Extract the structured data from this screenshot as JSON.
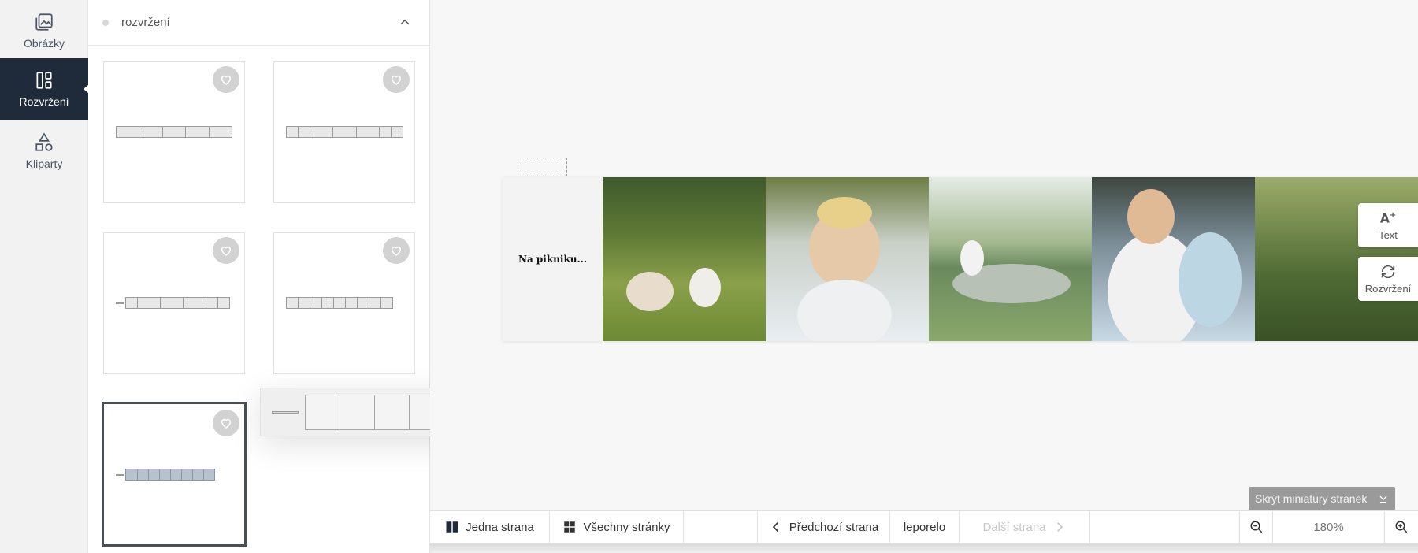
{
  "rail": {
    "items": [
      {
        "label": "Obrázky",
        "icon": "images-icon"
      },
      {
        "label": "Rozvržení",
        "icon": "layout-icon",
        "active": true
      },
      {
        "label": "Kliparty",
        "icon": "shapes-icon"
      }
    ]
  },
  "panel": {
    "title": "rozvržení"
  },
  "canvas": {
    "page_text": "Na pikniku...",
    "side_tools": {
      "text_label": "Text",
      "layout_label": "Rozvržení"
    },
    "hide_thumbs_label": "Skrýt miniatury stránek"
  },
  "toolbar": {
    "single_page": "Jedna strana",
    "all_pages": "Všechny stránky",
    "prev_page": "Předchozí strana",
    "product": "leporelo",
    "next_page": "Další strana",
    "zoom": "180%"
  },
  "colors": {
    "rail_active": "#1f2b3a",
    "selected_border": "#4a4f57",
    "selected_fill": "#b7c2cf"
  }
}
